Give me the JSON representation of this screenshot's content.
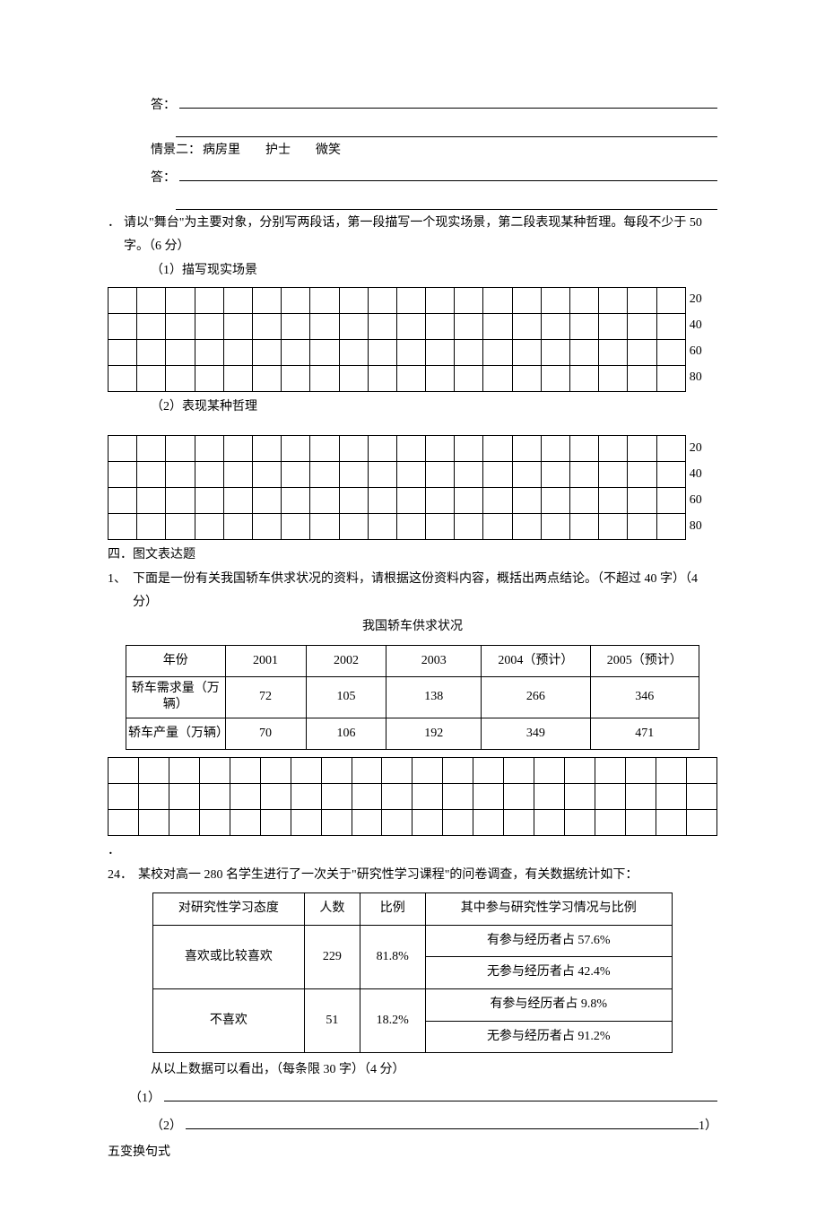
{
  "ans1": {
    "label": "答："
  },
  "scenario2": {
    "prefix": "情景二：",
    "place": "病房里",
    "role": "护士",
    "word": "微笑"
  },
  "ans2": {
    "label": "答："
  },
  "q_stage": {
    "marker": "．",
    "text": "请以\"舞台\"为主要对象，分别写两段话，第一段描写一个现实场景，第二段表现某种哲理。每段不少于 50 字。（6 分）",
    "sub1": "（1）描写现实场景",
    "sub2": "（2）表现某种哲理"
  },
  "grid_rows": [
    "20",
    "40",
    "60",
    "80"
  ],
  "sec4": {
    "heading": "四．图文表达题"
  },
  "q_car": {
    "marker": "1、",
    "text": "下面是一份有关我国轿车供求状况的资料，请根据这份资料内容，概括出两点结论。（不超过 40 字）（4 分）",
    "caption": "我国轿车供求状况"
  },
  "chart_data": {
    "type": "table",
    "title": "我国轿车供求状况",
    "row_header_col": "年份",
    "categories": [
      "2001",
      "2002",
      "2003",
      "2004（预计）",
      "2005（预计）"
    ],
    "series": [
      {
        "name": "轿车需求量（万辆）",
        "values": [
          72,
          105,
          138,
          266,
          346
        ]
      },
      {
        "name": "轿车产量（万辆）",
        "values": [
          70,
          106,
          192,
          349,
          471
        ]
      }
    ]
  },
  "q24": {
    "marker": "24．",
    "text": "某校对高一 280 名学生进行了一次关于\"研究性学习课程\"的问卷调查，有关数据统计如下：",
    "tail": "从以上数据可以看出，（每条限 30 字）（4 分）",
    "a1_label": "（1）",
    "a2_label": "（2）",
    "a2_tail": "1）"
  },
  "survey": {
    "headers": [
      "对研究性学习态度",
      "人数",
      "比例",
      "其中参与研究性学习情况与比例"
    ],
    "rows": [
      {
        "attitude": "喜欢或比较喜欢",
        "count": "229",
        "ratio": "81.8%",
        "detail": [
          "有参与经历者占 57.6%",
          "无参与经历者占 42.4%"
        ]
      },
      {
        "attitude": "不喜欢",
        "count": "51",
        "ratio": "18.2%",
        "detail": [
          "有参与经历者占 9.8%",
          "无参与经历者占 91.2%"
        ]
      }
    ]
  },
  "sec5": {
    "heading": "五变换句式"
  }
}
